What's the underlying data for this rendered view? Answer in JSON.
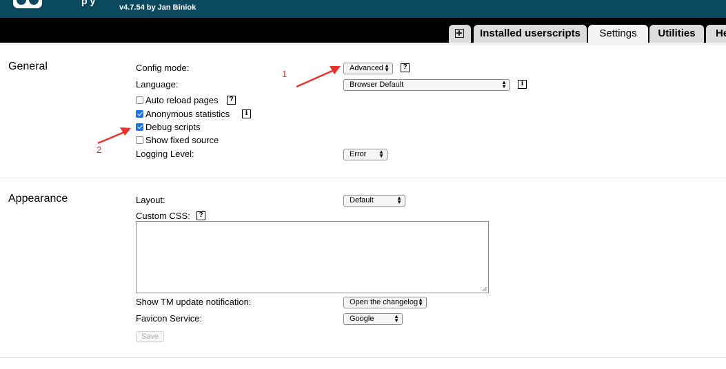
{
  "header": {
    "subtitle": "v4.7.54 by Jan Biniok",
    "partial_title": "p   y"
  },
  "tabs": [
    {
      "label": "Installed userscripts",
      "active": false
    },
    {
      "label": "Settings",
      "active": true
    },
    {
      "label": "Utilities",
      "active": false
    },
    {
      "label": "He",
      "active": false
    }
  ],
  "general": {
    "title": "General",
    "config_mode_label": "Config mode:",
    "config_mode_value": "Advanced",
    "language_label": "Language:",
    "language_value": "Browser Default",
    "auto_reload_label": "Auto reload pages",
    "auto_reload_checked": false,
    "anon_stats_label": "Anonymous statistics",
    "anon_stats_checked": true,
    "debug_scripts_label": "Debug scripts",
    "debug_scripts_checked": true,
    "fixed_source_label": "Show fixed source",
    "fixed_source_checked": false,
    "logging_label": "Logging Level:",
    "logging_value": "Error"
  },
  "appearance": {
    "title": "Appearance",
    "layout_label": "Layout:",
    "layout_value": "Default",
    "custom_css_label": "Custom CSS:",
    "custom_css_value": "",
    "update_notif_label": "Show TM update notification:",
    "update_notif_value": "Open the changelog",
    "favicon_label": "Favicon Service:",
    "favicon_value": "Google",
    "save_label": "Save"
  },
  "annotations": {
    "one": "1",
    "two": "2"
  },
  "icons": {
    "help": "?",
    "info": "i"
  },
  "colors": {
    "header_bg": "#0b4a5e",
    "tabbar_bg": "#000000",
    "annotation_red": "#e8322b",
    "checkbox_blue": "#1a73e8"
  }
}
